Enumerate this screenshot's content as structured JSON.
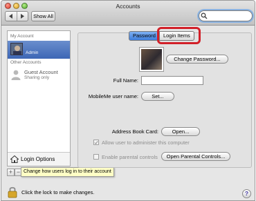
{
  "window": {
    "title": "Accounts"
  },
  "toolbar": {
    "show_all_label": "Show All",
    "search_value": ""
  },
  "sidebar": {
    "my_account_header": "My Account",
    "my_account": {
      "name": "",
      "role": "Admin"
    },
    "other_accounts_header": "Other Accounts",
    "guest": {
      "name": "Guest Account",
      "status": "Sharing only"
    },
    "login_options_label": "Login Options"
  },
  "tooltip": {
    "text": "Change how users log in to their account"
  },
  "tabs": {
    "password": "Password",
    "login_items": "Login Items"
  },
  "form": {
    "change_password_label": "Change Password...",
    "full_name_label": "Full Name:",
    "full_name_value": "",
    "mobileme_label": "MobileMe user name:",
    "set_label": "Set...",
    "address_book_label": "Address Book Card:",
    "open_label": "Open...",
    "allow_admin_label": "Allow user to administer this computer",
    "parental_label": "Enable parental controls",
    "open_parental_label": "Open Parental Controls..."
  },
  "footer": {
    "lock_text": "Click the lock to make changes.",
    "help_label": "?"
  },
  "colors": {
    "selection": "#3d66b5",
    "highlight": "#d21f28",
    "tab_active": "#3d7ddc",
    "tooltip_bg": "#ffffc6"
  }
}
